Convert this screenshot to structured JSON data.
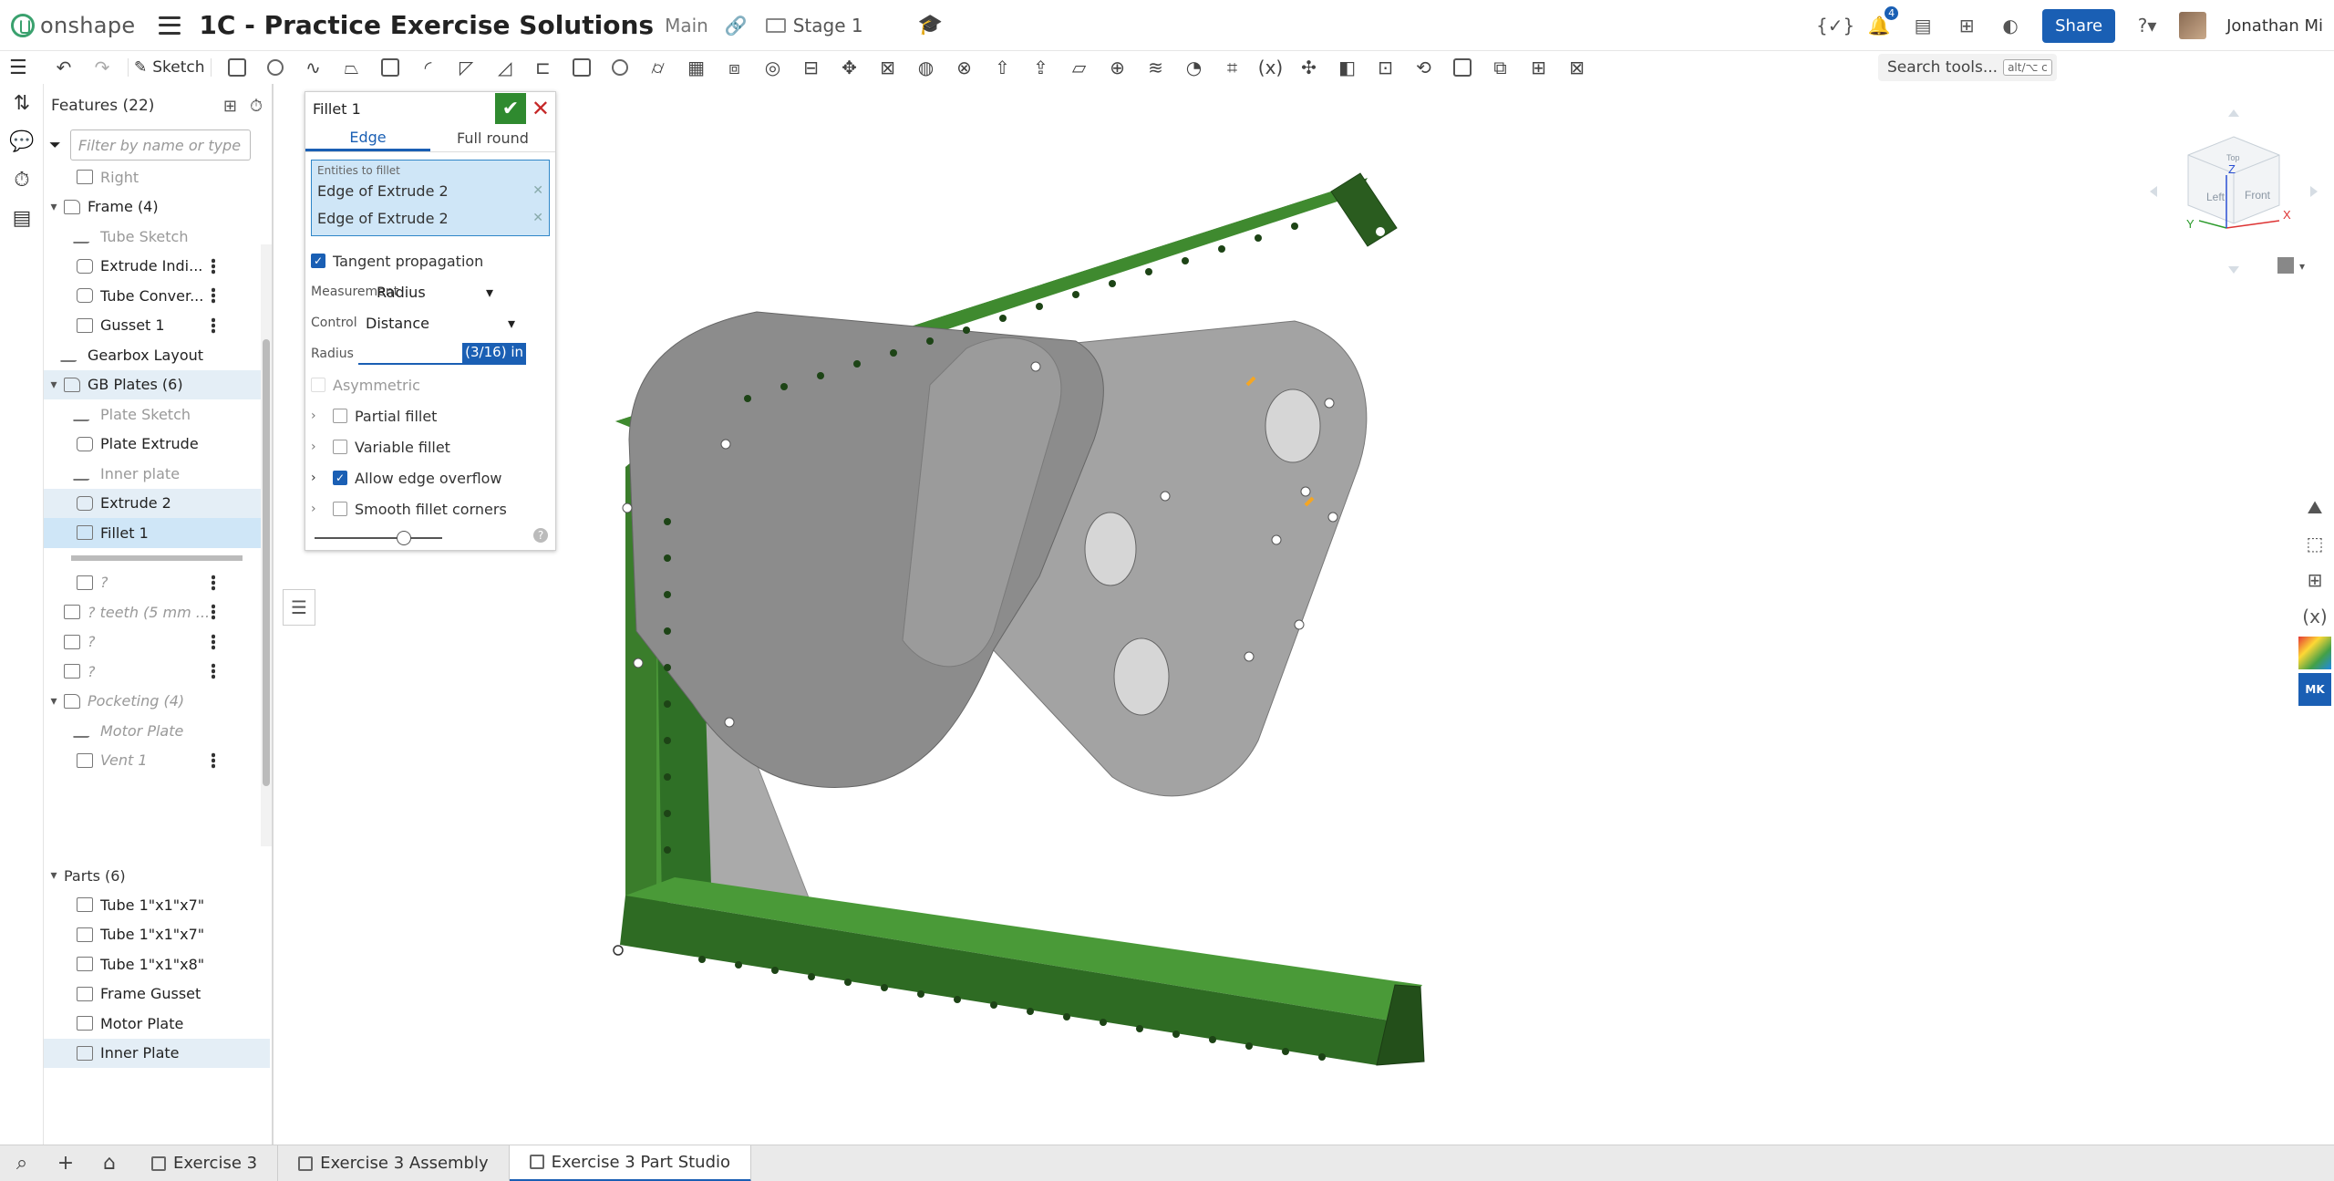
{
  "header": {
    "logo_text": "onshape",
    "doc_title": "1C - Practice Exercise Solutions",
    "branch": "Main",
    "stage": "Stage 1",
    "notif_count": "4",
    "share_label": "Share",
    "user_name": "Jonathan Mi"
  },
  "toolbar": {
    "sketch_label": "Sketch",
    "search_placeholder": "Search tools...",
    "search_shortcut": "alt/⌥ c"
  },
  "feature_panel": {
    "title": "Features (22)",
    "filter_placeholder": "Filter by name or type",
    "items": [
      {
        "label": "Right",
        "icon": "plane-icon",
        "style": "dim",
        "indent": 1
      },
      {
        "label": "Frame (4)",
        "icon": "folder-icon",
        "style": "normal",
        "indent": 0,
        "chevron": "▾"
      },
      {
        "label": "Tube Sketch",
        "icon": "sketch-icon",
        "style": "dim",
        "indent": 1
      },
      {
        "label": "Extrude Indi...",
        "icon": "extrude-icon",
        "style": "normal",
        "indent": 1,
        "dots": true
      },
      {
        "label": "Tube Conver...",
        "icon": "tube-icon",
        "style": "normal",
        "indent": 1,
        "dots": true
      },
      {
        "label": "Gusset 1",
        "icon": "gusset-icon",
        "style": "normal",
        "indent": 1,
        "dots": true
      },
      {
        "label": "Gearbox Layout",
        "icon": "sketch-icon",
        "style": "normal",
        "indent": 0
      },
      {
        "label": "GB Plates (6)",
        "icon": "folder-icon",
        "style": "hl",
        "indent": 0,
        "chevron": "▾"
      },
      {
        "label": "Plate Sketch",
        "icon": "sketch-icon",
        "style": "dim",
        "indent": 1
      },
      {
        "label": "Plate Extrude",
        "icon": "extrude-icon",
        "style": "normal",
        "indent": 1
      },
      {
        "label": "Inner plate",
        "icon": "sketch-icon",
        "style": "dim",
        "indent": 1
      },
      {
        "label": "Extrude 2",
        "icon": "extrude-icon",
        "style": "hl",
        "indent": 1
      },
      {
        "label": "Fillet 1",
        "icon": "fillet-icon",
        "style": "sel",
        "indent": 1
      }
    ],
    "after_items": [
      {
        "label": "?",
        "icon": "custom-feature-icon",
        "style": "ital",
        "indent": 1,
        "dots": true
      },
      {
        "label": "? teeth (5 mm ...",
        "icon": "cb-icon",
        "style": "ital",
        "indent": 0,
        "dots": true
      },
      {
        "label": "?",
        "icon": "custom-feature-icon",
        "style": "ital",
        "indent": 0,
        "dots": true
      },
      {
        "label": "?",
        "icon": "custom-feature-icon",
        "style": "ital",
        "indent": 0,
        "dots": true
      },
      {
        "label": "Pocketing (4)",
        "icon": "folder-icon",
        "style": "ital",
        "indent": 0,
        "chevron": "▾"
      },
      {
        "label": "Motor Plate",
        "icon": "sketch-icon",
        "style": "ital",
        "indent": 1
      },
      {
        "label": "Vent 1",
        "icon": "vent-icon",
        "style": "ital",
        "indent": 1,
        "dots": true
      }
    ],
    "parts_title": "Parts (6)",
    "parts": [
      "Tube 1\"x1\"x7\"",
      "Tube 1\"x1\"x7\"",
      "Tube 1\"x1\"x8\"",
      "Frame Gusset",
      "Motor Plate",
      "Inner Plate"
    ]
  },
  "fillet_dialog": {
    "title": "Fillet 1",
    "tabs": [
      "Edge",
      "Full round"
    ],
    "entities_label": "Entities to fillet",
    "entities": [
      "Edge of Extrude 2",
      "Edge of Extrude 2"
    ],
    "tangent_propagation": "Tangent propagation",
    "measurement_label": "Measurement",
    "measurement_value": "Radius",
    "control_label": "Control",
    "control_value": "Distance",
    "radius_label": "Radius",
    "radius_value": "(3/16) in",
    "asymmetric": "Asymmetric",
    "partial_fillet": "Partial fillet",
    "variable_fillet": "Variable fillet",
    "allow_edge_overflow": "Allow edge overflow",
    "smooth_fillet_corners": "Smooth fillet corners"
  },
  "viewcube": {
    "top": "Top",
    "left": "Left",
    "front": "Front",
    "axis_x": "X",
    "axis_y": "Y",
    "axis_z": "Z"
  },
  "bottom_tabs": [
    {
      "label": "Exercise 3",
      "icon": "folder-icon"
    },
    {
      "label": "Exercise 3 Assembly",
      "icon": "assembly-icon"
    },
    {
      "label": "Exercise 3 Part Studio",
      "icon": "partstudio-icon"
    }
  ],
  "colors": {
    "accent": "#1a5fb4",
    "frame_green": "#2e7d32",
    "plate_gray": "#8c8c8c",
    "selection": "#cfe6f7"
  }
}
